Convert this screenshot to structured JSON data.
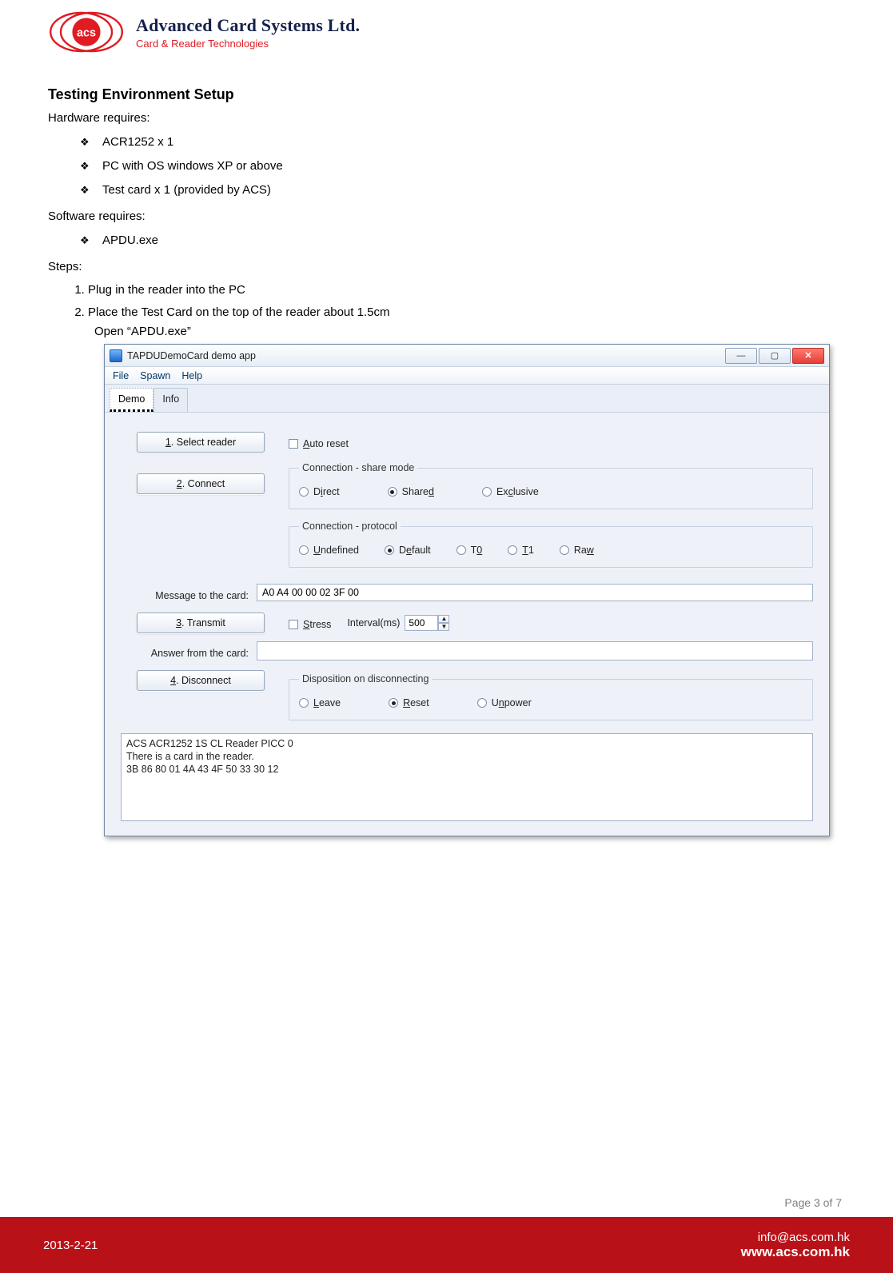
{
  "header": {
    "company": "Advanced Card Systems Ltd.",
    "tagline": "Card & Reader Technologies"
  },
  "doc": {
    "h1": "Testing Environment Setup",
    "hw_label": "Hardware requires:",
    "hw_items": [
      "ACR1252 x 1",
      "PC with OS windows XP or above",
      "Test card x 1 (provided by ACS)"
    ],
    "sw_label": "Software requires:",
    "sw_items": [
      "APDU.exe"
    ],
    "steps_label": "Steps:",
    "steps": [
      "Plug in the reader into the PC",
      "Place the Test Card on the top of the reader about 1.5cm"
    ],
    "step2_sub": "Open “APDU.exe”"
  },
  "app": {
    "title": "TAPDUDemoCard demo app",
    "menus": [
      "File",
      "Spawn",
      "Help"
    ],
    "tabs": {
      "active": "Demo",
      "other": "Info"
    },
    "buttons": {
      "select_reader": "1. Select reader",
      "connect": "2. Connect",
      "transmit": "3. Transmit",
      "disconnect": "4. Disconnect"
    },
    "auto_reset": "Auto reset",
    "share_mode": {
      "legend": "Connection - share mode",
      "direct": "Direct",
      "shared": "Shared",
      "exclusive": "Exclusive",
      "selected": "shared"
    },
    "protocol": {
      "legend": "Connection - protocol",
      "undefined": "Undefined",
      "default": "Default",
      "t0": "T0",
      "t1": "T1",
      "raw": "Raw",
      "selected": "default"
    },
    "msg_label": "Message to the card:",
    "msg_value": "A0 A4 00 00 02 3F 00",
    "stress": "Stress",
    "interval_label": "Interval(ms)",
    "interval_value": "500",
    "answer_label": "Answer from the card:",
    "dispo": {
      "legend": "Disposition on disconnecting",
      "leave": "Leave",
      "reset": "Reset",
      "unpower": "Unpower",
      "selected": "reset"
    },
    "log": "ACS ACR1252 1S CL Reader PICC 0\nThere is a card in the reader.\n3B 86 80 01 4A 43 4F 50 33 30 12"
  },
  "footer": {
    "page": "Page 3 of 7",
    "date": "2013-2-21",
    "email": "info@acs.com.hk",
    "site": "www.acs.com.hk"
  }
}
